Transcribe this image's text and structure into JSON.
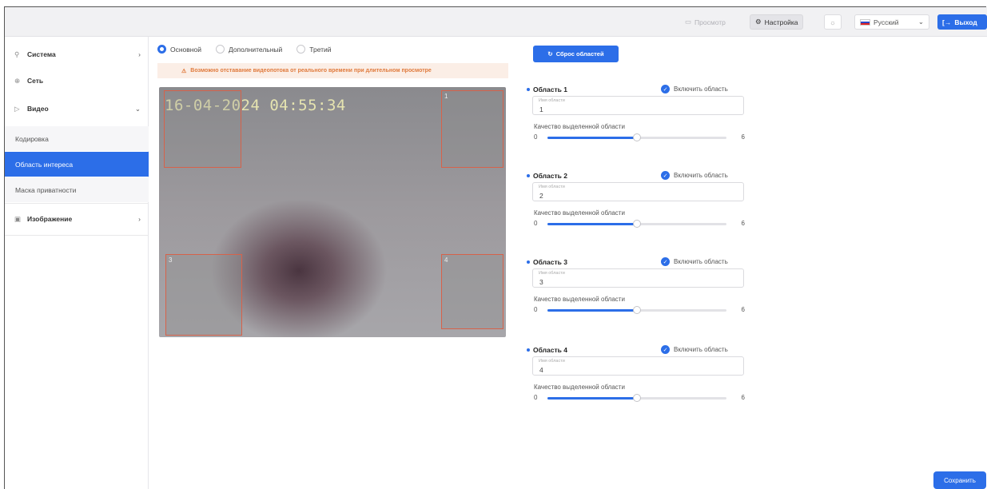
{
  "topbar": {
    "view_label": "Просмотр",
    "settings_label": "Настройка",
    "language": "Русский",
    "exit_label": "Выход"
  },
  "sidebar": {
    "items": [
      {
        "label": "Система",
        "icon": "wrench-icon"
      },
      {
        "label": "Сеть",
        "icon": "network-icon"
      },
      {
        "label": "Видео",
        "icon": "video-icon"
      },
      {
        "label": "Изображение",
        "icon": "image-icon"
      }
    ],
    "video_sub": [
      "Кодировка",
      "Область интереса",
      "Маска приватности"
    ],
    "active_sub": "Область интереса"
  },
  "streams": {
    "options": [
      "Основной",
      "Дополнительный",
      "Третий"
    ],
    "selected": "Основной"
  },
  "warning_text": "Возможно отставание видеопотока от реального времени при длительном просмотре",
  "video": {
    "timestamp": "16-04-2024 04:55:34",
    "roi_labels": [
      "1",
      "2",
      "3",
      "4"
    ]
  },
  "reset_label": "Сброс областей",
  "areas": [
    {
      "title": "Область 1",
      "enable_label": "Включить область",
      "name_label": "Имя области",
      "name": "1",
      "quality_label": "Качество выделенной области",
      "min": "0",
      "max": "6",
      "value": 3
    },
    {
      "title": "Область 2",
      "enable_label": "Включить область",
      "name_label": "Имя области",
      "name": "2",
      "quality_label": "Качество выделенной области",
      "min": "0",
      "max": "6",
      "value": 3
    },
    {
      "title": "Область 3",
      "enable_label": "Включить область",
      "name_label": "Имя области",
      "name": "3",
      "quality_label": "Качество выделенной области",
      "min": "0",
      "max": "6",
      "value": 3
    },
    {
      "title": "Область 4",
      "enable_label": "Включить область",
      "name_label": "Имя области",
      "name": "4",
      "quality_label": "Качество выделенной области",
      "min": "0",
      "max": "6",
      "value": 3
    }
  ],
  "save_label": "Сохранить",
  "colors": {
    "accent": "#2c6ee8",
    "roi_border": "#d6624a",
    "warning": "#e07a3c"
  }
}
